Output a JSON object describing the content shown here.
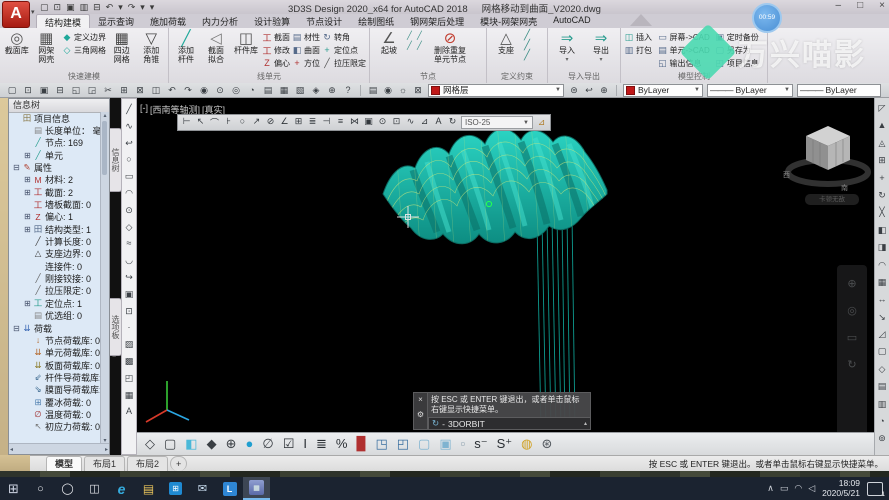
{
  "titlebar": {
    "app_title": "3D3S Design 2020_x64 for AutoCAD 2018",
    "doc_title": "网格移动到曲面_V2020.dwg",
    "recording_time": "00:59",
    "logo_letter": "A",
    "min": "–",
    "max": "□",
    "close": "×"
  },
  "qat": {
    "icons": [
      {
        "n": "new-icon",
        "g": "▢"
      },
      {
        "n": "open-icon",
        "g": "⊡"
      },
      {
        "n": "save-icon",
        "g": "▣"
      },
      {
        "n": "save-as-icon",
        "g": "▥"
      },
      {
        "n": "plot-icon",
        "g": "⊟"
      },
      {
        "n": "undo-icon",
        "g": "↶"
      },
      {
        "n": "undo-dropdown-icon",
        "g": "▾"
      },
      {
        "n": "redo-icon",
        "g": "↷"
      },
      {
        "n": "redo-dropdown-icon",
        "g": "▾"
      },
      {
        "n": "qat-customize-icon",
        "g": "▾"
      }
    ]
  },
  "ribbon_tabs": [
    {
      "t": "结构建模",
      "cls": "active"
    },
    {
      "t": "显示查询",
      "cls": ""
    },
    {
      "t": "施加荷载",
      "cls": ""
    },
    {
      "t": "内力分析",
      "cls": ""
    },
    {
      "t": "设计验算",
      "cls": ""
    },
    {
      "t": "节点设计",
      "cls": ""
    },
    {
      "t": "绘制图纸",
      "cls": ""
    },
    {
      "t": "钢网架后处理",
      "cls": ""
    },
    {
      "t": "模块-网架网壳",
      "cls": ""
    },
    {
      "t": "AutoCAD",
      "cls": ""
    }
  ],
  "ribbon": {
    "groups": {
      "g1": "快速建模",
      "g2": "线单元",
      "g3": "节点",
      "g4": "定义约束",
      "g5": "导入导出",
      "g6": "模型控制"
    },
    "btn": {
      "jmk": "截面库",
      "wjwk": "网架\n网壳",
      "dybj": "定义边界",
      "sjwg": "三角网格",
      "sbwg": "四边\n网格",
      "tjjz": "添加\n角锥",
      "tjgj": "添加\n杆件",
      "jmnh": "截面\n拟合",
      "gjk": "杆件库",
      "jm": "截面",
      "xg": "修改",
      "px": "偏心",
      "cx": "材性",
      "qm": "曲面",
      "fw": "方位",
      "zj": "转角",
      "dwd": "定位点",
      "lyxd": "拉压限定",
      "qp": "起坡",
      "sccf": "删除重复\n单元节点",
      "zz": "支座",
      "dr": "导入",
      "dc": "导出",
      "cr": "插入",
      "db": "打包",
      "pm": "屏幕->CAD",
      "dy": "单元->CAD",
      "scxx": "输出信息",
      "dsbf": "定时备份",
      "lcw": "另存为",
      "xmxx": "项目信息"
    },
    "ico": {
      "jmk": "◎",
      "wjwk": "▦",
      "dybj": "◆",
      "sjwg": "◇",
      "sbwg": "▦",
      "tjjz": "▽",
      "tjgj": "╱",
      "jmnh": "◁",
      "gjk": "◫",
      "jm": "工",
      "xg": "工",
      "px": "Z",
      "cx": "▤",
      "qm": "◧",
      "fw": "+",
      "zj": "↻",
      "dwd": "+",
      "lyxd": "╱",
      "qp": "∠",
      "sccf": "⊘",
      "zz": "△",
      "dr": "⇒",
      "dc": "⇒",
      "cr": "◫",
      "db": "▥",
      "pm": "▭",
      "dy": "▤",
      "scxx": "◱",
      "dsbf": "▣",
      "lcw": "▢",
      "xmxx": "◰",
      "dropdown": "▾"
    },
    "mini1": [
      {
        "g": "╱"
      },
      {
        "g": "╱"
      },
      {
        "g": "╱"
      },
      {
        "g": "╱"
      }
    ],
    "mini2": [
      {
        "g": "╱"
      },
      {
        "g": "╱"
      },
      {
        "g": "╱"
      }
    ]
  },
  "watermark": {
    "text": "万兴喵影"
  },
  "stdbar": {
    "icons1": [
      {
        "n": "new-icon",
        "g": "▢"
      },
      {
        "n": "open-icon",
        "g": "⊡"
      },
      {
        "n": "save-icon",
        "g": "▣"
      },
      {
        "n": "plot-icon",
        "g": "⊟"
      },
      {
        "n": "preview-icon",
        "g": "◱"
      },
      {
        "n": "publish-icon",
        "g": "◲"
      },
      {
        "n": "cut-icon",
        "g": "✂"
      },
      {
        "n": "copy-icon",
        "g": "⊞"
      },
      {
        "n": "paste-icon",
        "g": "⊠"
      },
      {
        "n": "match-properties-icon",
        "g": "◫"
      },
      {
        "n": "undo-icon",
        "g": "↶"
      },
      {
        "n": "redo-icon",
        "g": "↷"
      },
      {
        "n": "pan-icon",
        "g": "◉"
      },
      {
        "n": "zoom-realtime-icon",
        "g": "⊙"
      },
      {
        "n": "zoom-window-icon",
        "g": "◎"
      },
      {
        "n": "zoom-previous-icon",
        "g": "◔"
      },
      {
        "n": "properties-icon",
        "g": "▤"
      },
      {
        "n": "designcenter-icon",
        "g": "▦"
      },
      {
        "n": "tool-palettes-icon",
        "g": "▧"
      },
      {
        "n": "sheetset-icon",
        "g": "◈"
      },
      {
        "n": "markup-icon",
        "g": "⊕"
      },
      {
        "n": "help-icon",
        "g": "?"
      }
    ],
    "layer_tools": [
      {
        "n": "layer-properties-icon",
        "g": "▤"
      },
      {
        "n": "layer-on-icon",
        "g": "◉"
      },
      {
        "n": "layer-freeze-icon",
        "g": "☼"
      },
      {
        "n": "layer-lock-icon",
        "g": "⊠"
      }
    ],
    "layer_name": "网格层",
    "post_icons": [
      {
        "n": "make-current-icon",
        "g": "⊜"
      },
      {
        "n": "layer-previous-icon",
        "g": "↩"
      },
      {
        "n": "layer-states-icon",
        "g": "⊕"
      }
    ],
    "color_value": "ByLayer",
    "linetype_value": "ByLayer",
    "lineweight_value": "ByLayer",
    "line_glyph": "———"
  },
  "panel": {
    "title": "信息树",
    "tab1": "信息树",
    "tab2": "选项板",
    "up_arrow": "▴",
    "down_arrow": "▾",
    "left_arrow": "◂",
    "right_arrow": "▸",
    "tree": [
      {
        "e": "",
        "i": "田",
        "c": "#8a7a4a",
        "t": "项目信息",
        "lv": "lv1"
      },
      {
        "e": "",
        "i": "▤",
        "c": "#888888",
        "t": "长度单位： 毫米",
        "lv": "lv2"
      },
      {
        "e": "",
        "i": "╱",
        "c": "#2a9d8f",
        "t": "节点:  169",
        "lv": "lv2"
      },
      {
        "e": "⊞",
        "i": "╱",
        "c": "#2a9d8f",
        "t": "单元",
        "lv": "lv2"
      },
      {
        "e": "⊟",
        "i": "✎",
        "c": "#b04030",
        "t": "属性",
        "lv": "lv1"
      },
      {
        "e": "⊞",
        "i": "M",
        "c": "#b03030",
        "t": "材料: 2",
        "lv": "lv2"
      },
      {
        "e": "⊞",
        "i": "工",
        "c": "#b03030",
        "t": "截面:  2",
        "lv": "lv2"
      },
      {
        "e": "",
        "i": "工",
        "c": "#b03030",
        "t": "墙板截面: 0",
        "lv": "lv2"
      },
      {
        "e": "⊞",
        "i": "Z",
        "c": "#b03030",
        "t": "偏心: 1",
        "lv": "lv2"
      },
      {
        "e": "⊞",
        "i": "田",
        "c": "#556a8a",
        "t": "结构类型: 1",
        "lv": "lv2"
      },
      {
        "e": "",
        "i": "╱",
        "c": "#444444",
        "t": "计算长度: 0",
        "lv": "lv2"
      },
      {
        "e": "",
        "i": "△",
        "c": "#444444",
        "t": "支座边界: 0",
        "lv": "lv2"
      },
      {
        "e": "",
        "i": "",
        "c": "#444444",
        "t": "连接件: 0",
        "lv": "lv2"
      },
      {
        "e": "",
        "i": "╱",
        "c": "#666666",
        "t": "刚接铰接: 0",
        "lv": "lv2"
      },
      {
        "e": "",
        "i": "╱",
        "c": "#666666",
        "t": "拉压限定: 0",
        "lv": "lv2"
      },
      {
        "e": "⊞",
        "i": "工",
        "c": "#2a9d8f",
        "t": "定位点: 1",
        "lv": "lv2"
      },
      {
        "e": "",
        "i": "▤",
        "c": "#888888",
        "t": "优选组: 0",
        "lv": "lv2"
      },
      {
        "e": "⊟",
        "i": "⇊",
        "c": "#3060b0",
        "t": "荷载",
        "lv": "lv1"
      },
      {
        "e": "",
        "i": "↓",
        "c": "#b06020",
        "t": "节点荷载库: 0",
        "lv": "lv2"
      },
      {
        "e": "",
        "i": "⇊",
        "c": "#b06020",
        "t": "单元荷载库: 0",
        "lv": "lv2"
      },
      {
        "e": "",
        "i": "⇊",
        "c": "#887720",
        "t": "板面荷载库: 0",
        "lv": "lv2"
      },
      {
        "e": "",
        "i": "⇙",
        "c": "#306088",
        "t": "杆件导荷载库: 0",
        "lv": "lv2"
      },
      {
        "e": "",
        "i": "⇘",
        "c": "#306088",
        "t": "膜面导荷载库: 0",
        "lv": "lv2"
      },
      {
        "e": "",
        "i": "⊞",
        "c": "#5080b0",
        "t": "覆冰荷载: 0",
        "lv": "lv2"
      },
      {
        "e": "",
        "i": "∅",
        "c": "#a03030",
        "t": "温度荷载: 0",
        "lv": "lv2"
      },
      {
        "e": "",
        "i": "↖",
        "c": "#777777",
        "t": "初应力荷载: 0",
        "lv": "lv2"
      }
    ]
  },
  "lefttools": [
    {
      "n": "line-icon",
      "g": "╱"
    },
    {
      "n": "spline-icon",
      "g": "∿"
    },
    {
      "n": "revcloud-icon",
      "g": "↩"
    },
    {
      "n": "circle-icon",
      "g": "○"
    },
    {
      "n": "rectangle-icon",
      "g": "▭"
    },
    {
      "n": "arc-icon",
      "g": "◠"
    },
    {
      "n": "donut-icon",
      "g": "⊙"
    },
    {
      "n": "polygon-icon",
      "g": "◇"
    },
    {
      "n": "multiline-icon",
      "g": "≈"
    },
    {
      "n": "arc3p-icon",
      "g": "◡"
    },
    {
      "n": "polyline-icon",
      "g": "↪"
    },
    {
      "n": "block-icon",
      "g": "▣"
    },
    {
      "n": "insert-block-icon",
      "g": "⊡"
    },
    {
      "n": "point-icon",
      "g": "·"
    },
    {
      "n": "hatch-icon",
      "g": "▨"
    },
    {
      "n": "gradient-icon",
      "g": "▩"
    },
    {
      "n": "boundary-icon",
      "g": "◰"
    },
    {
      "n": "table-icon",
      "g": "▦"
    },
    {
      "n": "text-icon",
      "g": "A"
    }
  ],
  "righttools": [
    {
      "n": "erase-icon",
      "g": "◸"
    },
    {
      "n": "extrude-icon",
      "g": "▲"
    },
    {
      "n": "pyramid-icon",
      "g": "◬"
    },
    {
      "n": "array-icon",
      "g": "⊞"
    },
    {
      "n": "move-icon",
      "g": "+"
    },
    {
      "n": "rotate-icon",
      "g": "↻"
    },
    {
      "n": "trim-icon",
      "g": "╳"
    },
    {
      "n": "offset-left-icon",
      "g": "◧"
    },
    {
      "n": "offset-right-icon",
      "g": "◨"
    },
    {
      "n": "fillet-icon",
      "g": "◠"
    },
    {
      "n": "grid-icon",
      "g": "▦"
    },
    {
      "n": "stretch-icon",
      "g": "↔"
    },
    {
      "n": "scale-icon",
      "g": "↘"
    },
    {
      "n": "chamfer-icon",
      "g": "◿"
    },
    {
      "n": "box-icon",
      "g": "▢"
    },
    {
      "n": "diamond-icon",
      "g": "◇"
    },
    {
      "n": "list-icon",
      "g": "▤"
    },
    {
      "n": "measure-icon",
      "g": "▥"
    },
    {
      "n": "divide-icon",
      "g": "◔"
    },
    {
      "n": "region-icon",
      "g": "⊚"
    }
  ],
  "viewport": {
    "label_collapse": "[-]",
    "label_view": "[西南等轴测]",
    "label_visual": "[真实]",
    "pill": "卡顿无敌",
    "viewcube_left": "西",
    "viewcube_front": "南"
  },
  "dimbar": {
    "icons": [
      {
        "n": "linear-dim-icon",
        "g": "⊢"
      },
      {
        "n": "aligned-dim-icon",
        "g": "↖"
      },
      {
        "n": "arc-length-icon",
        "g": "⌒"
      },
      {
        "n": "ordinate-icon",
        "g": "⊦"
      },
      {
        "n": "radius-icon",
        "g": "○"
      },
      {
        "n": "jogged-icon",
        "g": "↗"
      },
      {
        "n": "diameter-icon",
        "g": "⊘"
      },
      {
        "n": "angular-icon",
        "g": "∠"
      },
      {
        "n": "quick-dim-icon",
        "g": "⊞"
      },
      {
        "n": "baseline-icon",
        "g": "≣"
      },
      {
        "n": "continue-icon",
        "g": "⊣"
      },
      {
        "n": "dim-space-icon",
        "g": "≡"
      },
      {
        "n": "dim-break-icon",
        "g": "⋈"
      },
      {
        "n": "tolerance-icon",
        "g": "▣"
      },
      {
        "n": "center-mark-icon",
        "g": "⊙"
      },
      {
        "n": "inspection-icon",
        "g": "⊡"
      },
      {
        "n": "jog-line-icon",
        "g": "∿"
      },
      {
        "n": "dim-edit-icon",
        "g": "⊿"
      },
      {
        "n": "dim-text-edit-icon",
        "g": "A"
      },
      {
        "n": "dim-update-icon",
        "g": "↻"
      }
    ],
    "style_value": "ISO-25",
    "end_icon": "⊿"
  },
  "navbar_icons": [
    {
      "g": "⊕"
    },
    {
      "g": "◎"
    },
    {
      "g": "▭"
    },
    {
      "g": "↻"
    }
  ],
  "command": {
    "message": "按 ESC 或 ENTER 键退出，或者单击鼠标右键显示快捷菜单。",
    "prompt_icon": "↻",
    "dash": "-",
    "value": "3DORBIT",
    "close": "×",
    "wrench": "⚙",
    "dropdown": "▴"
  },
  "vbottom": [
    {
      "n": "wireframe-view-icon",
      "g": "◇",
      "c": "#3a3f44"
    },
    {
      "n": "hidden-view-icon",
      "g": "▢",
      "c": "#3a3f44"
    },
    {
      "n": "shaded-view-icon",
      "g": "◧",
      "c": "#49b8d8"
    },
    {
      "n": "faces-view-icon",
      "g": "◆",
      "c": "#3a3f44"
    },
    {
      "n": "overlap-circles-icon",
      "g": "⊕",
      "c": "#3a3f44"
    },
    {
      "n": "render-sphere-icon",
      "g": "●",
      "c": "#1f9fd0"
    },
    {
      "n": "section-icon",
      "g": "∅",
      "c": "#3a3f44"
    },
    {
      "n": "select-check-icon",
      "g": "☑",
      "c": "#2a2f34"
    },
    {
      "n": "beam-check-icon",
      "g": "I",
      "c": "#2a2f34"
    },
    {
      "n": "layer-stack-icon",
      "g": "≣",
      "c": "#2a2f34"
    },
    {
      "n": "percent-check-icon",
      "g": "%",
      "c": "#2a2f34"
    },
    {
      "n": "properties-panel-icon",
      "g": "▉",
      "c": "#b03030"
    },
    {
      "n": "corner-window-icon",
      "g": "◳",
      "c": "#3a6fa0"
    },
    {
      "n": "corner-window2-icon",
      "g": "◰",
      "c": "#3a6fa0"
    },
    {
      "n": "pale-square-icon",
      "g": "▢",
      "c": "#7fb3d0"
    },
    {
      "n": "filled-square-icon",
      "g": "▣",
      "c": "#7fb3d0"
    },
    {
      "n": "dashed-square-icon",
      "g": "▫",
      "c": "#8fa3b0"
    },
    {
      "n": "s-minus-icon",
      "g": "s⁻",
      "c": "#2a2f34"
    },
    {
      "n": "s-plus-icon",
      "g": "S⁺",
      "c": "#2a2f34"
    },
    {
      "n": "unlock-icon",
      "g": "◍",
      "c": "#d0a020"
    },
    {
      "n": "settings-gear-icon",
      "g": "⊛",
      "c": "#50565c"
    }
  ],
  "statusbar": {
    "tabs": [
      {
        "t": "模型",
        "cls": "active"
      },
      {
        "t": "布局1",
        "cls": ""
      },
      {
        "t": "布局2",
        "cls": ""
      },
      {
        "t": "+",
        "cls": "plus"
      }
    ],
    "hint": "按 ESC 或 ENTER 键退出。或者单击鼠标右键显示快捷菜单。"
  },
  "taskbar": {
    "icons": [
      {
        "n": "start-icon",
        "g": "⊞",
        "cls": "tb-start",
        "wrap": ""
      },
      {
        "n": "search-icon",
        "g": "○",
        "cls": "",
        "wrap": ""
      },
      {
        "n": "cortana-icon",
        "g": "◯",
        "cls": "",
        "wrap": ""
      },
      {
        "n": "task-view-icon",
        "g": "◫",
        "cls": "",
        "wrap": ""
      },
      {
        "n": "edge-icon",
        "g": "e",
        "cls": "tb-edge",
        "wrap": ""
      },
      {
        "n": "file-explorer-icon",
        "g": "▤",
        "cls": "tb-folder",
        "wrap": ""
      },
      {
        "n": "store-icon",
        "g": "⊞",
        "cls": "tb-store",
        "wrap": "bag"
      },
      {
        "n": "mail-icon",
        "g": "✉",
        "cls": "tb-mail",
        "wrap": ""
      },
      {
        "n": "l-app-icon",
        "g": "L",
        "cls": "tb-lapp",
        "wrap": "bag"
      },
      {
        "n": "cad-app-icon",
        "g": "▦",
        "cls": "tb-active",
        "wrap": "bag"
      }
    ],
    "tray": [
      {
        "n": "hidden-icons-chevron",
        "g": "∧"
      },
      {
        "n": "battery-icon",
        "g": "▭"
      },
      {
        "n": "wifi-icon",
        "g": "◠"
      },
      {
        "n": "volume-icon",
        "g": "◁"
      }
    ],
    "time": "18:09",
    "date": "2020/5/21",
    "badge": "1"
  }
}
